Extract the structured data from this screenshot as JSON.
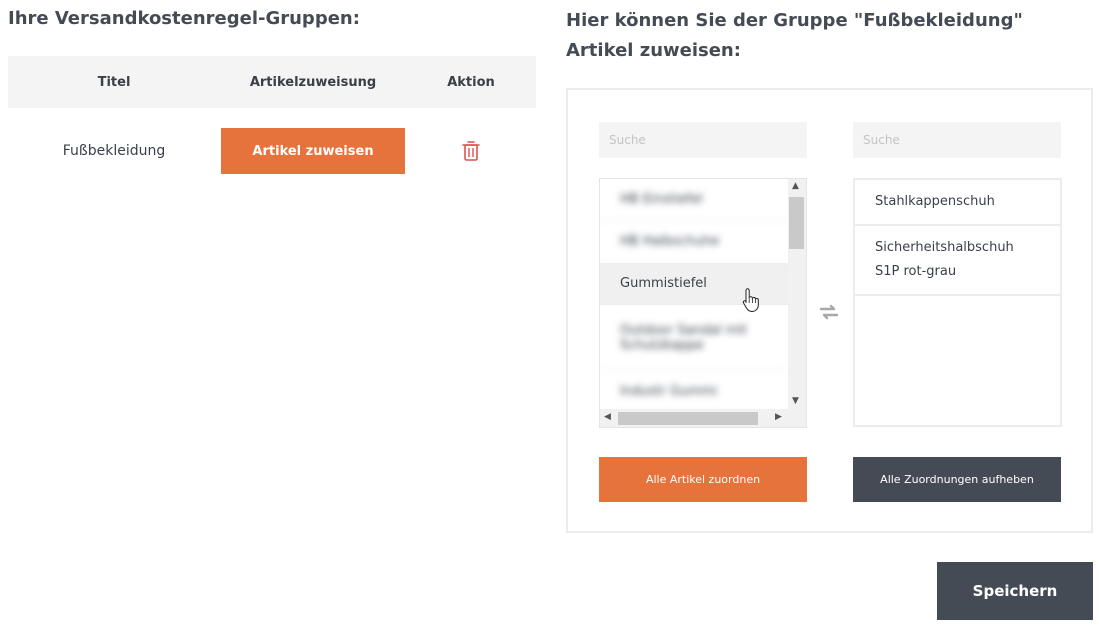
{
  "left": {
    "title": "Ihre Versandkostenregel-Gruppen:",
    "table": {
      "headers": {
        "title": "Titel",
        "assignment": "Artikelzuweisung",
        "action": "Aktion"
      },
      "rows": [
        {
          "title": "Fußbekleidung",
          "assign_button": "Artikel zuweisen",
          "delete_icon": "trash-icon"
        }
      ]
    }
  },
  "right": {
    "title": "Hier können Sie der Gruppe \"Fußbekleidung\" Artikel zuweisen:",
    "available": {
      "search_placeholder": "Suche",
      "items": [
        {
          "label": "HB Einstiefel",
          "blurred": true
        },
        {
          "label": "HB Halbschuhe",
          "blurred": true
        },
        {
          "label": "Gummistiefel",
          "blurred": false
        },
        {
          "label": "Outdoor Sandal mit Schutzkappe",
          "blurred": true
        },
        {
          "label": "Industr Gummi",
          "blurred": true
        }
      ]
    },
    "assigned": {
      "search_placeholder": "Suche",
      "items": [
        {
          "label": "Stahlkappenschuh"
        },
        {
          "label": "Sicherheitshalbschuh S1P rot-grau"
        }
      ]
    },
    "transfer_icon": "swap-arrows-icon",
    "assign_all_button": "Alle Artikel zuordnen",
    "remove_all_button": "Alle Zuordnungen aufheben"
  },
  "save_button": "Speichern",
  "colors": {
    "accent": "#e6733b",
    "dark": "#454b55",
    "light_bg": "#f4f4f4",
    "delete": "#d9534f"
  }
}
